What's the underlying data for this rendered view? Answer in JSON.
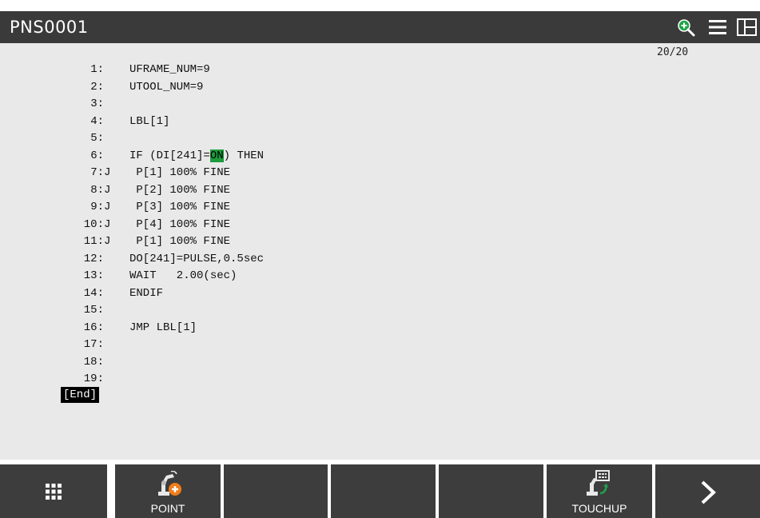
{
  "header": {
    "title": "PNS0001",
    "icons": [
      "zoom-in-icon",
      "menu-icon",
      "split-screen-icon"
    ],
    "accent_color": "#1fa54a",
    "background_color": "#3a3a3a"
  },
  "editor": {
    "line_counter": "20/20",
    "highlight_color": "#1d9a3c",
    "lines": [
      {
        "num": "1",
        "flag": "",
        "pre": "UFRAME_NUM=9",
        "hl": "",
        "post": ""
      },
      {
        "num": "2",
        "flag": "",
        "pre": "UTOOL_NUM=9",
        "hl": "",
        "post": ""
      },
      {
        "num": "3",
        "flag": "",
        "pre": "",
        "hl": "",
        "post": ""
      },
      {
        "num": "4",
        "flag": "",
        "pre": "LBL[1]",
        "hl": "",
        "post": ""
      },
      {
        "num": "5",
        "flag": "",
        "pre": "",
        "hl": "",
        "post": ""
      },
      {
        "num": "6",
        "flag": "",
        "pre": "IF (DI[241]=",
        "hl": "ON",
        "post": ") THEN"
      },
      {
        "num": "7",
        "flag": "J",
        "pre": " P[1] 100% FINE",
        "hl": "",
        "post": ""
      },
      {
        "num": "8",
        "flag": "J",
        "pre": " P[2] 100% FINE",
        "hl": "",
        "post": ""
      },
      {
        "num": "9",
        "flag": "J",
        "pre": " P[3] 100% FINE",
        "hl": "",
        "post": ""
      },
      {
        "num": "10",
        "flag": "J",
        "pre": " P[4] 100% FINE",
        "hl": "",
        "post": ""
      },
      {
        "num": "11",
        "flag": "J",
        "pre": " P[1] 100% FINE",
        "hl": "",
        "post": ""
      },
      {
        "num": "12",
        "flag": "",
        "pre": "DO[241]=PULSE,0.5sec",
        "hl": "",
        "post": ""
      },
      {
        "num": "13",
        "flag": "",
        "pre": "WAIT   2.00(sec)",
        "hl": "",
        "post": ""
      },
      {
        "num": "14",
        "flag": "",
        "pre": "ENDIF",
        "hl": "",
        "post": ""
      },
      {
        "num": "15",
        "flag": "",
        "pre": "",
        "hl": "",
        "post": ""
      },
      {
        "num": "16",
        "flag": "",
        "pre": "JMP LBL[1]",
        "hl": "",
        "post": ""
      },
      {
        "num": "17",
        "flag": "",
        "pre": "",
        "hl": "",
        "post": ""
      },
      {
        "num": "18",
        "flag": "",
        "pre": "",
        "hl": "",
        "post": ""
      },
      {
        "num": "19",
        "flag": "",
        "pre": "",
        "hl": "",
        "post": ""
      }
    ],
    "end_marker": "[End]"
  },
  "function_keys": [
    {
      "label": "",
      "icon": "grid-menu-icon"
    },
    {
      "label": "POINT",
      "icon": "robot-add-point-icon"
    },
    {
      "label": "",
      "icon": ""
    },
    {
      "label": "",
      "icon": ""
    },
    {
      "label": "",
      "icon": ""
    },
    {
      "label": "TOUCHUP",
      "icon": "robot-touchup-icon"
    },
    {
      "label": "",
      "icon": "chevron-right-icon"
    }
  ]
}
